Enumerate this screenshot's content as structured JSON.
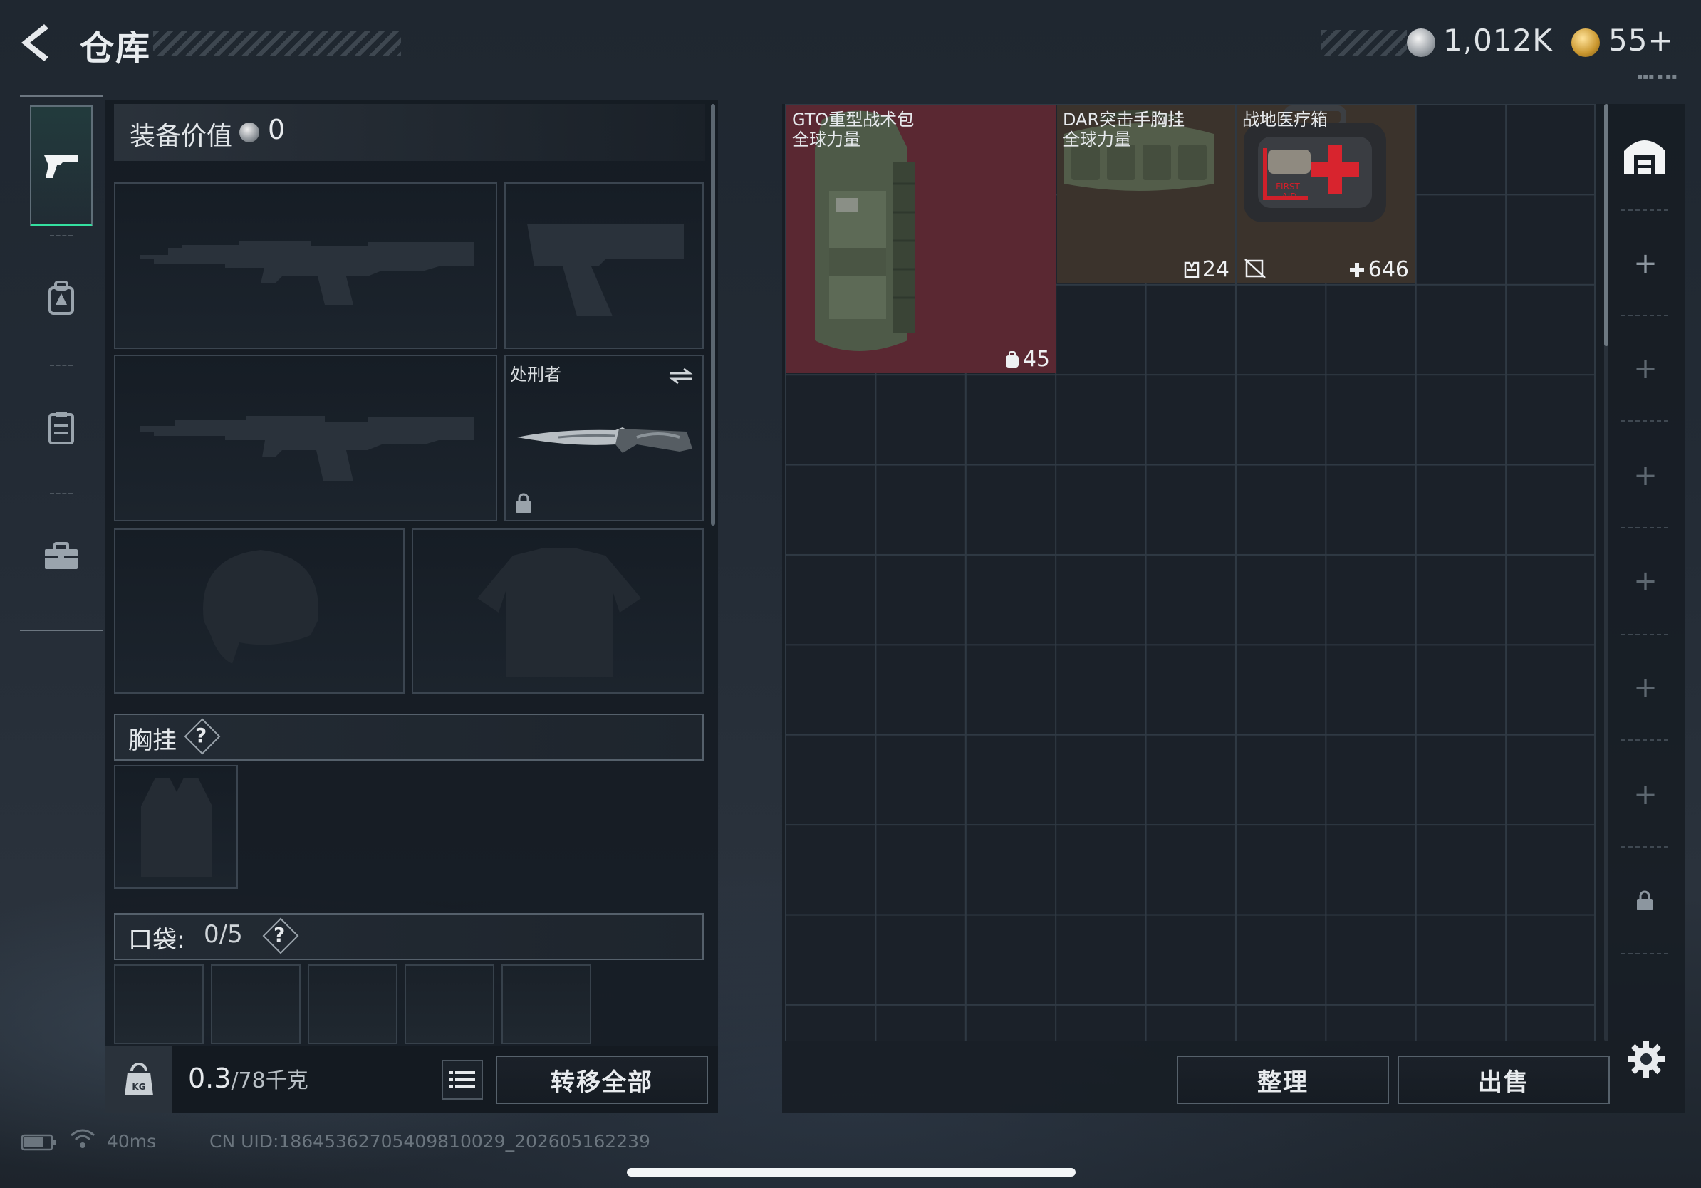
{
  "header": {
    "title": "仓库",
    "currency_silver": "1,012K",
    "currency_gold": "55+",
    "tiny_label": "▪▪▪ ▪ ▪▪"
  },
  "equipment": {
    "value_label": "装备价值",
    "value": "0",
    "knife_name": "处刑者",
    "chest_rig_label": "胸挂",
    "help": "?",
    "pocket_label": "口袋:",
    "pocket_count": "0/5"
  },
  "weight": {
    "current": "0.3",
    "max": "/78千克"
  },
  "buttons": {
    "transfer_all": "转移全部",
    "organize": "整理",
    "sell": "出售"
  },
  "storage_items": [
    {
      "name_line1": "GTO重型战术包",
      "name_line2": "全球力量",
      "count": "45",
      "count_icon": "backpack-icon"
    },
    {
      "name_line1": "DAR突击手胸挂",
      "name_line2": "全球力量",
      "count": "24",
      "count_icon": "vest-icon"
    },
    {
      "name_line1": "战地医疗箱",
      "name_line2": "",
      "count": "646",
      "count_icon": "medical-cross-icon"
    }
  ],
  "footer": {
    "ping": "40ms",
    "uid": "CN UID:1864536270540981​0029_202605162239"
  },
  "colors": {
    "accent_green": "#34e0a0",
    "backpack_bg": "#5a2832",
    "item_bg": "#3b332c"
  }
}
